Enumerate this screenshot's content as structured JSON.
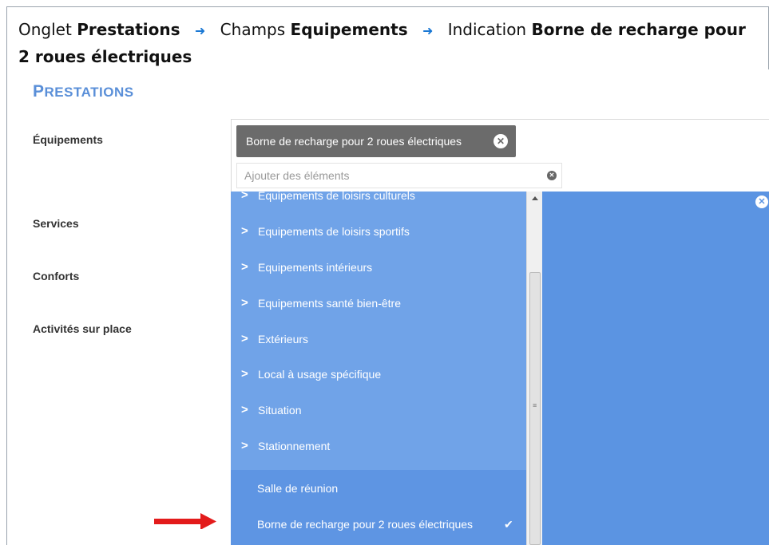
{
  "instruction": {
    "prefix_1": "Onglet",
    "tab": "Prestations",
    "prefix_2": "Champs",
    "field": "Equipements",
    "prefix_3": "Indication",
    "value": "Borne de recharge pour 2 roues électriques",
    "arrow_icon": "right-arrow-icon"
  },
  "section": {
    "title_first": "P",
    "title_rest": "RESTATIONS"
  },
  "labels": {
    "equipements": "Équipements",
    "services": "Services",
    "conforts": "Conforts",
    "activites": "Activités sur place"
  },
  "selector": {
    "tag_label": "Borne de recharge pour 2 roues électriques",
    "search_placeholder": "Ajouter des éléments"
  },
  "dropdown": {
    "groups": [
      "Equipements de loisirs culturels",
      "Equipements de loisirs sportifs",
      "Equipements intérieurs",
      "Equipements santé bien-être",
      "Extérieurs",
      "Local à usage spécifique",
      "Situation",
      "Stationnement"
    ],
    "options": [
      "Salle de réunion",
      "Borne de recharge pour 2 roues électriques"
    ]
  },
  "colors": {
    "dropdown_bg": "#70a3e8",
    "preview_bg": "#5b94e2",
    "accent_title": "#5a8fd8",
    "pointer": "#e31b1b"
  }
}
